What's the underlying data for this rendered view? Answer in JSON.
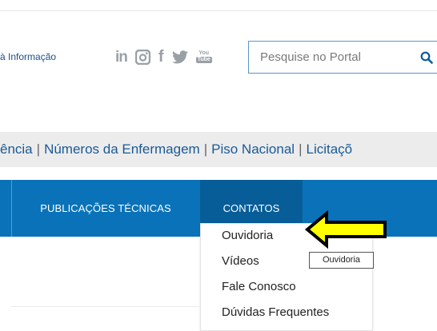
{
  "header": {
    "access_link": "à Informação",
    "social": [
      {
        "name": "linkedin",
        "glyph": "in"
      },
      {
        "name": "instagram",
        "glyph": ""
      },
      {
        "name": "facebook",
        "glyph": "f"
      },
      {
        "name": "twitter",
        "glyph": ""
      },
      {
        "name": "youtube",
        "glyph_top": "You",
        "glyph_bottom": "Tube"
      }
    ],
    "search": {
      "placeholder": "Pesquise no Portal",
      "value": ""
    }
  },
  "links_bar": {
    "items": [
      "ência",
      "Números da Enfermagem",
      "Piso Nacional",
      "Licitaçõ"
    ],
    "separator": "|"
  },
  "nav": {
    "items": [
      {
        "label": "PUBLICAÇÕES TÉCNICAS"
      },
      {
        "label": "CONTATOS"
      }
    ]
  },
  "dropdown": {
    "items": [
      "Ouvidoria",
      "Vídeos",
      "Fale Conosco",
      "Dúvidas Frequentes"
    ]
  },
  "tooltip": {
    "text": "Ouvidoria"
  },
  "annotation": {
    "color": "#ffff00",
    "outline": "#000000"
  },
  "colors": {
    "nav_bg": "#0a72b8",
    "nav_active_bg": "#075d98",
    "link": "#1a5a96",
    "icon_gray": "#9aa0a6"
  }
}
